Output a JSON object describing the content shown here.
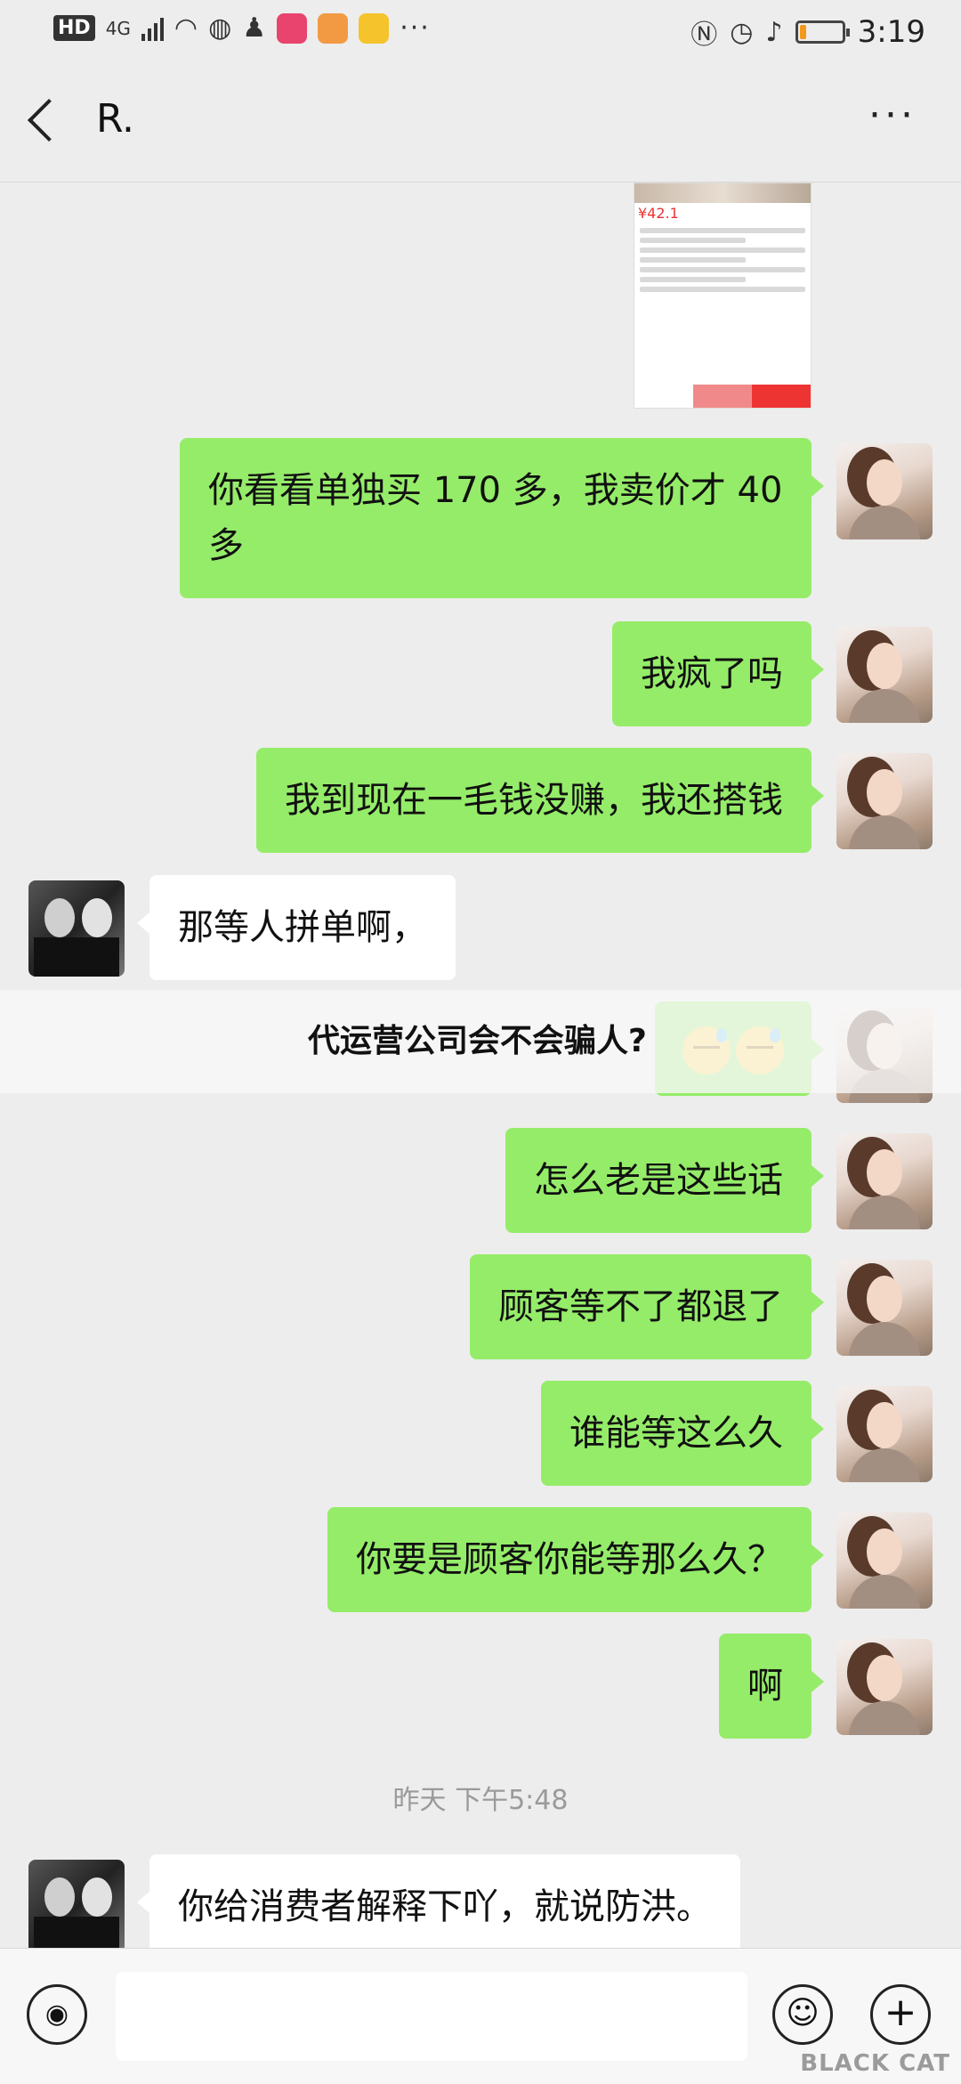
{
  "status_bar": {
    "hd_badge": "HD",
    "network": "4G",
    "dots": "···",
    "time": "3:19",
    "battery_level": 0.15,
    "battery_color": "#f39a1b"
  },
  "header": {
    "title": "R.",
    "back_icon": "chevron-left-icon",
    "more_icon": "more-dots-icon",
    "more_glyph": "···"
  },
  "messages": [
    {
      "from": "me",
      "type": "image",
      "price": "¥42.1"
    },
    {
      "from": "me",
      "text": "你看看单独买 170 多，我卖价才 40 多"
    },
    {
      "from": "me",
      "text": "我疯了吗"
    },
    {
      "from": "me",
      "text": "我到现在一毛钱没赚，我还搭钱"
    },
    {
      "from": "peer",
      "text": "那等人拼单啊，"
    },
    {
      "from": "me",
      "type": "emoji",
      "emoji": "cold-sweat-emoji"
    },
    {
      "from": "me",
      "text": "怎么老是这些话"
    },
    {
      "from": "me",
      "text": "顾客等不了都退了"
    },
    {
      "from": "me",
      "text": "谁能等这么久"
    },
    {
      "from": "me",
      "text": "你要是顾客你能等那么久？"
    },
    {
      "from": "me",
      "text": "啊"
    },
    {
      "type": "timestamp",
      "text": "昨天 下午5:48"
    },
    {
      "from": "peer",
      "text": "你给消费者解释下吖，就说防洪。"
    }
  ],
  "overlay_banner": {
    "text": "代运营公司会不会骗人?"
  },
  "input_bar": {
    "voice_icon": "voice-icon",
    "emoji_icon": "emoji-icon",
    "plus_icon": "plus-icon",
    "voice_glyph": "◉",
    "emoji_glyph": "☺",
    "plus_glyph": "+"
  },
  "watermark": "BLACK CAT",
  "colors": {
    "my_bubble": "#95ec69",
    "peer_bubble": "#ffffff",
    "background": "#ededed"
  }
}
